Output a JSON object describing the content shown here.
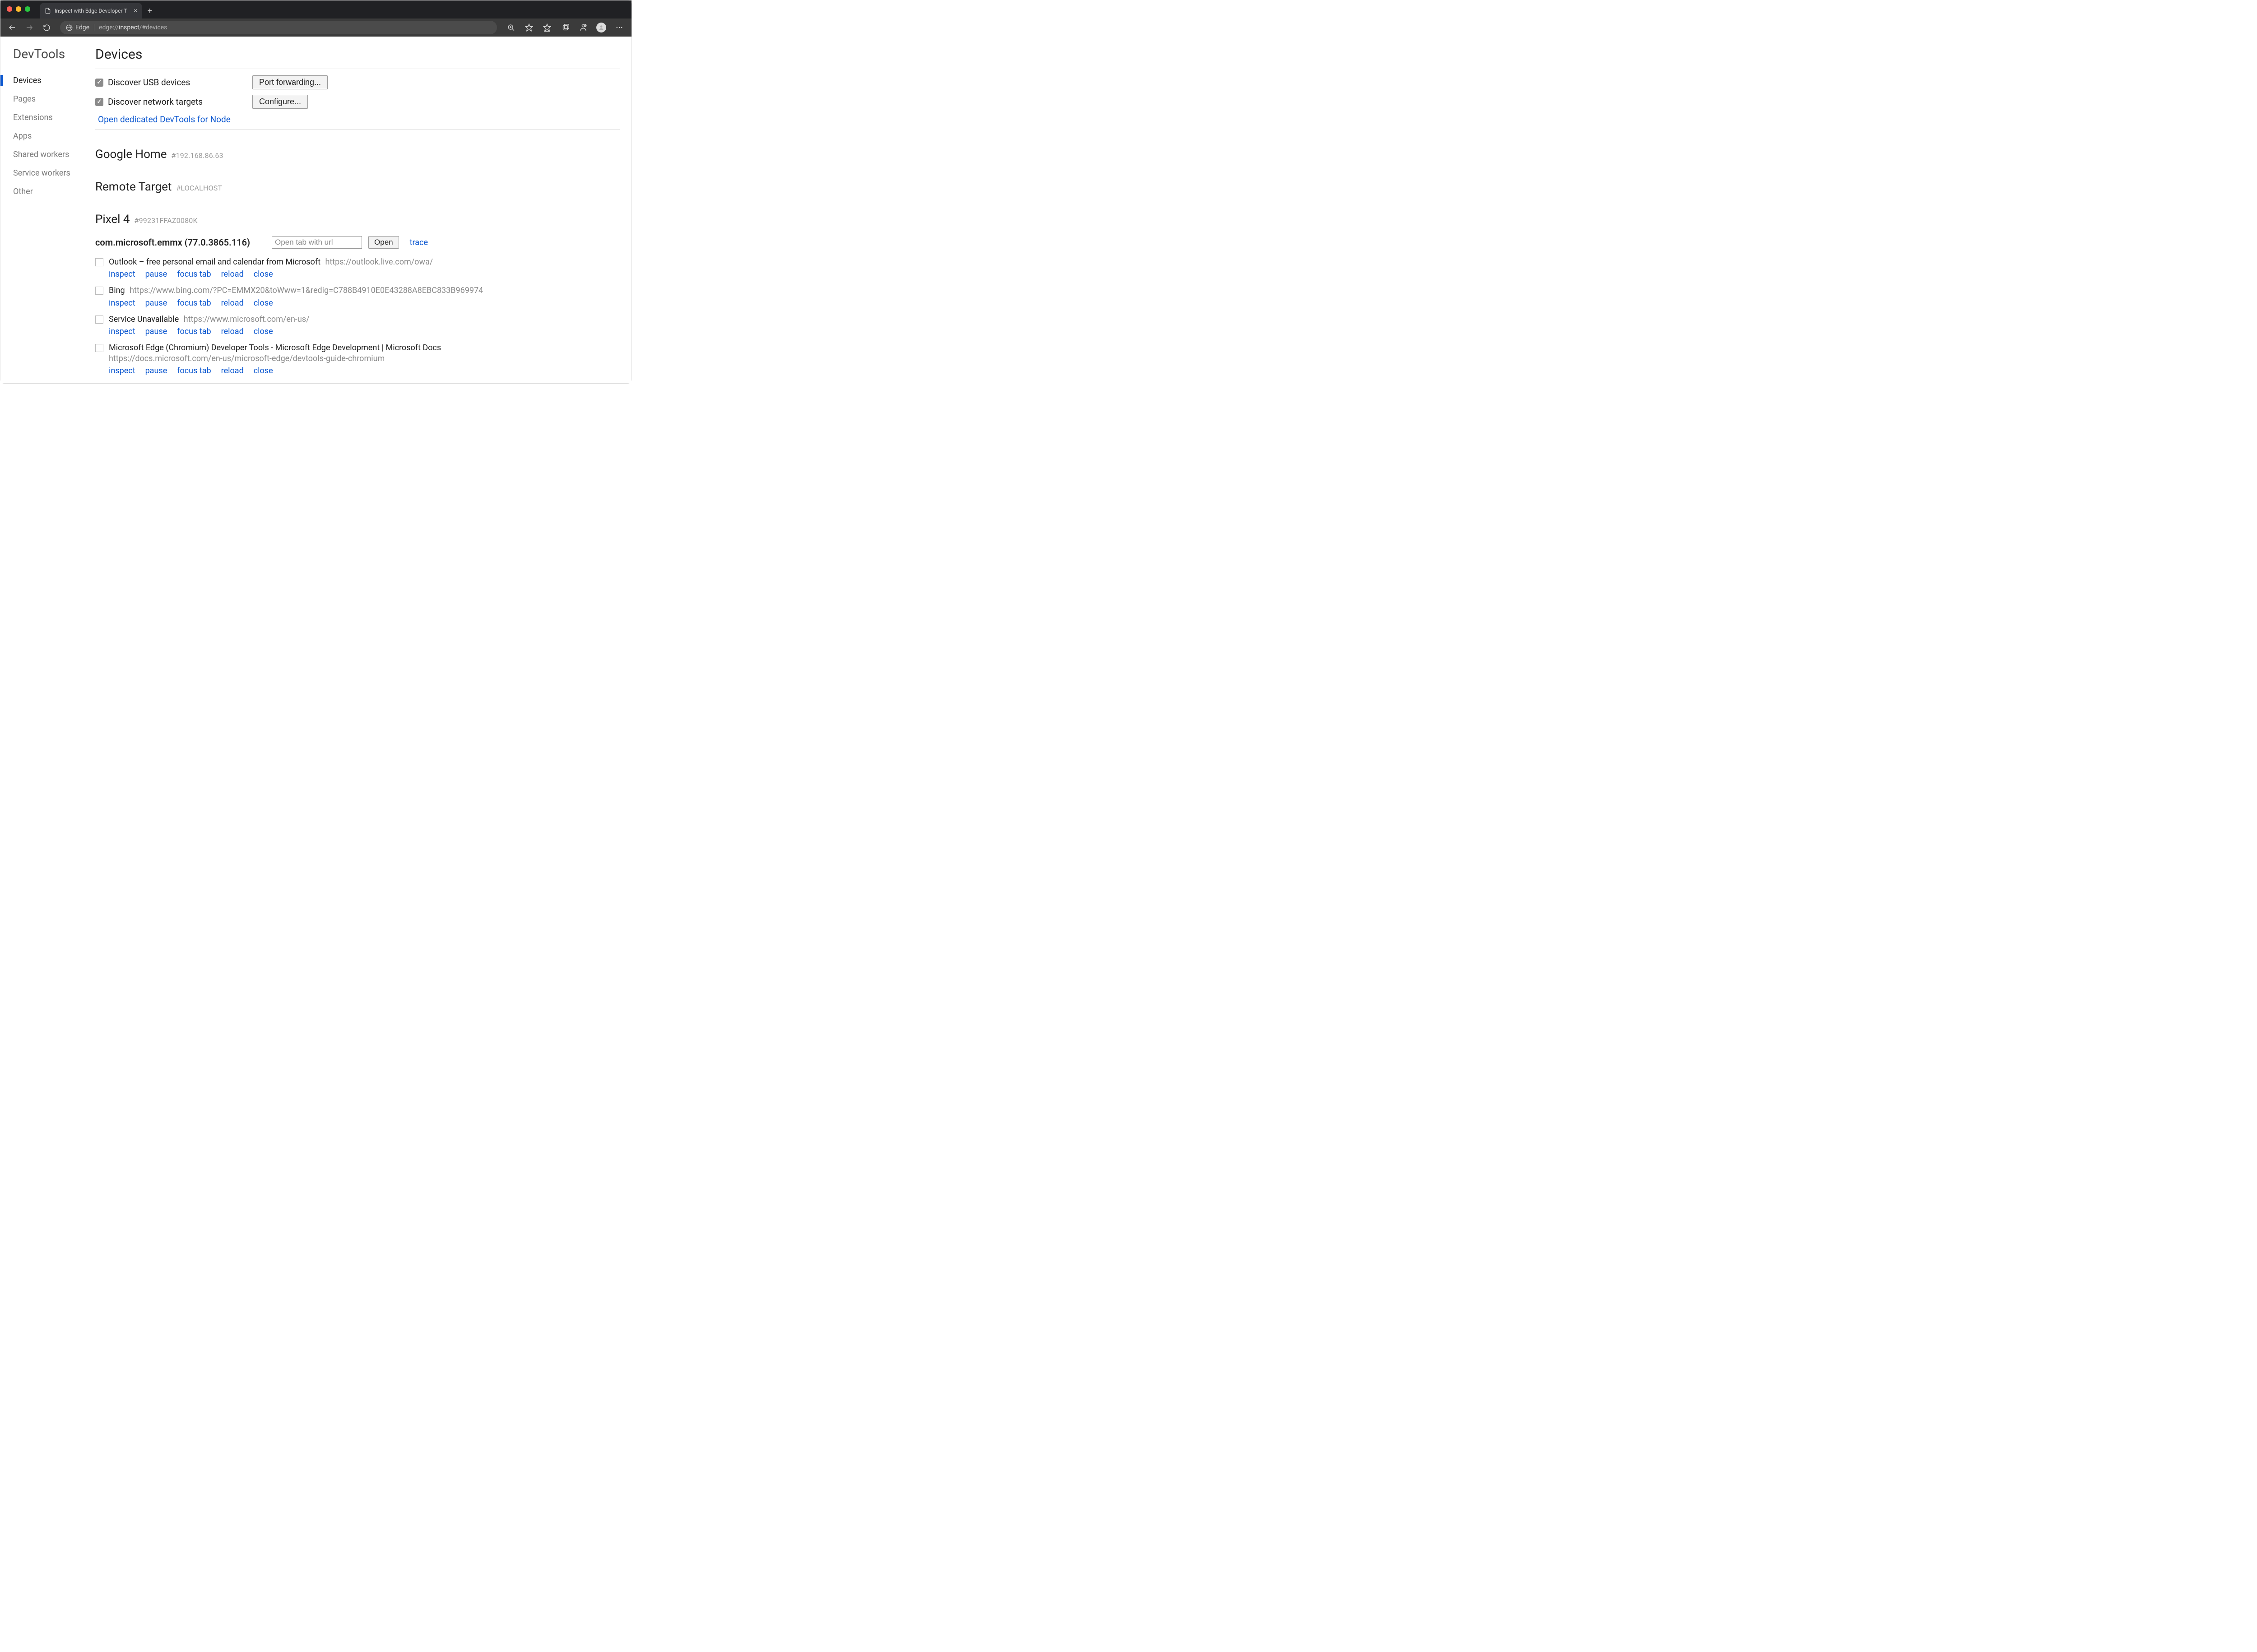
{
  "window": {
    "tab_title": "Inspect with Edge Developer T"
  },
  "toolbar": {
    "edge_label": "Edge",
    "url_dim1": "edge://",
    "url_strong": "inspect",
    "url_dim2": "/#devices"
  },
  "sidebar": {
    "brand": "DevTools",
    "items": [
      {
        "label": "Devices",
        "active": true
      },
      {
        "label": "Pages"
      },
      {
        "label": "Extensions"
      },
      {
        "label": "Apps"
      },
      {
        "label": "Shared workers"
      },
      {
        "label": "Service workers"
      },
      {
        "label": "Other"
      }
    ]
  },
  "page": {
    "title": "Devices",
    "discover_usb_label": "Discover USB devices",
    "discover_network_label": "Discover network targets",
    "port_forwarding_btn": "Port forwarding...",
    "configure_btn": "Configure...",
    "node_link": "Open dedicated DevTools for Node",
    "sections": [
      {
        "title": "Google Home",
        "hash": "#192.168.86.63"
      },
      {
        "title": "Remote Target",
        "hash": "#LOCALHOST"
      },
      {
        "title": "Pixel 4",
        "hash": "#99231FFAZ0080K"
      }
    ],
    "app": {
      "name": "com.microsoft.emmx (77.0.3865.116)",
      "open_placeholder": "Open tab with url",
      "open_btn": "Open",
      "trace_link": "trace"
    },
    "actions": {
      "inspect": "inspect",
      "pause": "pause",
      "focus": "focus tab",
      "reload": "reload",
      "close": "close"
    },
    "targets": [
      {
        "name": "Outlook – free personal email and calendar from Microsoft",
        "url": "https://outlook.live.com/owa/"
      },
      {
        "name": "Bing",
        "url": "https://www.bing.com/?PC=EMMX20&toWww=1&redig=C788B4910E0E43288A8EBC833B969974"
      },
      {
        "name": "Service Unavailable",
        "url": "https://www.microsoft.com/en-us/"
      },
      {
        "name": "Microsoft Edge (Chromium) Developer Tools - Microsoft Edge Development | Microsoft Docs",
        "url": "https://docs.microsoft.com/en-us/microsoft-edge/devtools-guide-chromium"
      }
    ]
  }
}
